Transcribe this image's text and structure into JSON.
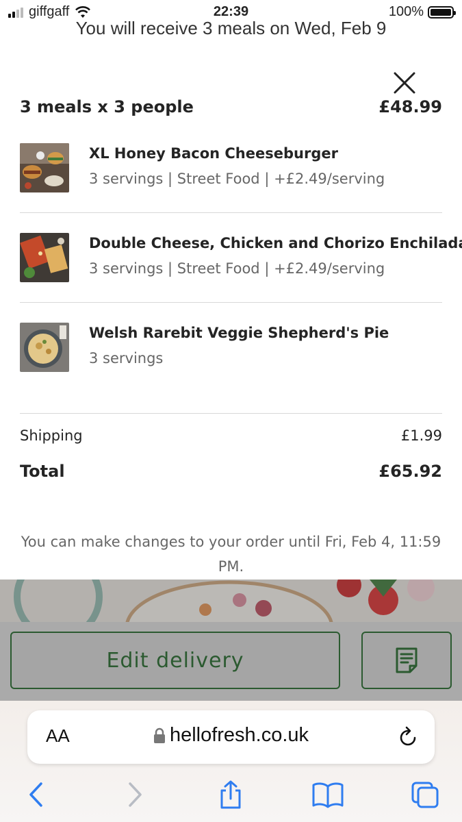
{
  "status_bar": {
    "carrier": "giffgaff",
    "time": "22:39",
    "battery": "100%"
  },
  "header": {
    "delivery_text": "You will receive 3 meals on Wed, Feb 9"
  },
  "summary": {
    "title": "3 meals x 3 people",
    "price": "£48.99"
  },
  "meals": [
    {
      "name": "XL Honey Bacon Cheeseburger",
      "meta": "3 servings | Street Food | +£2.49/serving"
    },
    {
      "name": "Double Cheese, Chicken and Chorizo Enchiladas",
      "meta": "3 servings | Street Food | +£2.49/serving"
    },
    {
      "name": "Welsh Rarebit Veggie Shepherd's Pie",
      "meta": "3 servings"
    }
  ],
  "totals": {
    "shipping_label": "Shipping",
    "shipping_value": "£1.99",
    "total_label": "Total",
    "total_value": "£65.92"
  },
  "note": "You can make changes to your order until Fri, Feb 4, 11:59 PM.",
  "actions": {
    "edit_delivery": "Edit delivery"
  },
  "browser": {
    "text_size_label": "AA",
    "url": "hellofresh.co.uk"
  },
  "colors": {
    "brand_green": "#2b5a30",
    "text": "#242424",
    "muted": "#666666"
  }
}
